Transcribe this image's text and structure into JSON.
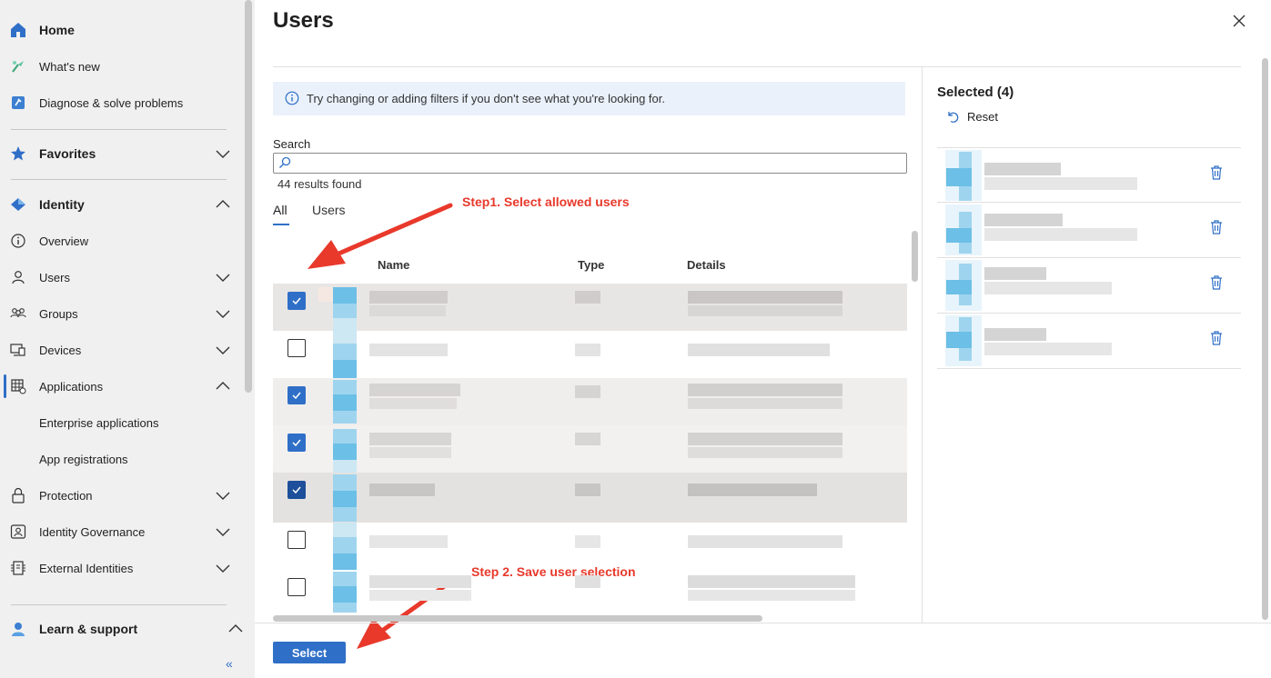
{
  "sidebar": {
    "home": "Home",
    "whats_new": "What's new",
    "diagnose": "Diagnose & solve problems",
    "favorites": "Favorites",
    "identity": "Identity",
    "overview": "Overview",
    "users": "Users",
    "groups": "Groups",
    "devices": "Devices",
    "applications": "Applications",
    "enterprise_apps": "Enterprise applications",
    "app_registrations": "App registrations",
    "protection": "Protection",
    "identity_governance": "Identity Governance",
    "external_identities": "External Identities",
    "learn_support": "Learn & support",
    "collapse": "«"
  },
  "panel": {
    "title": "Users",
    "info_text": "Try changing or adding filters if you don't see what you're looking for.",
    "search_label": "Search",
    "search_value": "",
    "results": "44 results found",
    "tabs": [
      "All",
      "Users"
    ],
    "columns": [
      "Name",
      "Type",
      "Details"
    ],
    "rows": [
      {
        "checked": true
      },
      {
        "checked": false
      },
      {
        "checked": true
      },
      {
        "checked": true
      },
      {
        "checked": true
      },
      {
        "checked": false
      },
      {
        "checked": false
      }
    ],
    "select_button": "Select"
  },
  "selected": {
    "title": "Selected (4)",
    "reset": "Reset",
    "count": 4
  },
  "annotations": {
    "step1": "Step1. Select allowed users",
    "step2": "Step 2. Save user selection"
  },
  "colors": {
    "accent": "#2f6fc7",
    "annotation": "#e8392b",
    "sidebar_bg": "#f0f0f0",
    "selected_row": "#e8e6e5"
  }
}
